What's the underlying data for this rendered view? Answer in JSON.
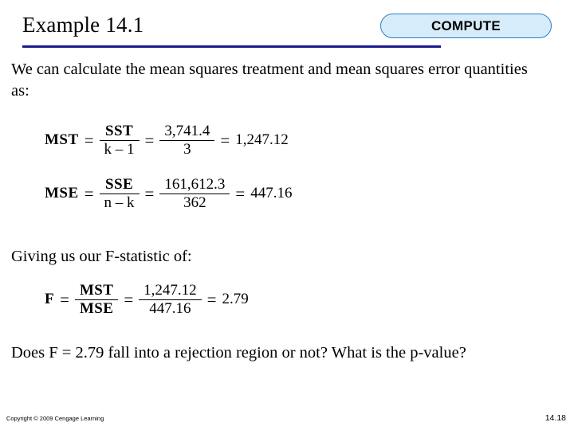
{
  "slide": {
    "title": "Example 14.1",
    "badge": "COMPUTE",
    "intro_text": "We can calculate the mean squares treatment and mean squares error quantities as:",
    "giving_text": "Giving us our F-statistic of:",
    "question_text": "Does F = 2.79 fall into a rejection region or not? What is the p-value?",
    "copyright": "Copyright © 2009 Cengage Learning",
    "page_number": "14.18",
    "accent_color": "#1a1a8c",
    "badge_fill": "#d7ecfb",
    "badge_stroke": "#2b7fc4",
    "equations": [
      {
        "lhs": "MST",
        "eq1": "=",
        "frac1_num": "SST",
        "frac1_den": "k – 1",
        "eq2": "=",
        "frac2_num": "3,741.4",
        "frac2_den": "3",
        "eq3": "=",
        "result": "1,247.12"
      },
      {
        "lhs": "MSE",
        "eq1": "=",
        "frac1_num": "SSE",
        "frac1_den": "n – k",
        "eq2": "=",
        "frac2_num": "161,612.3",
        "frac2_den": "362",
        "eq3": "=",
        "result": "447.16"
      },
      {
        "lhs": "F",
        "eq1": "=",
        "frac1_num": "MST",
        "frac1_den": "MSE",
        "eq2": "=",
        "frac2_num": "1,247.12",
        "frac2_den": "447.16",
        "eq3": "=",
        "result": "2.79"
      }
    ]
  }
}
